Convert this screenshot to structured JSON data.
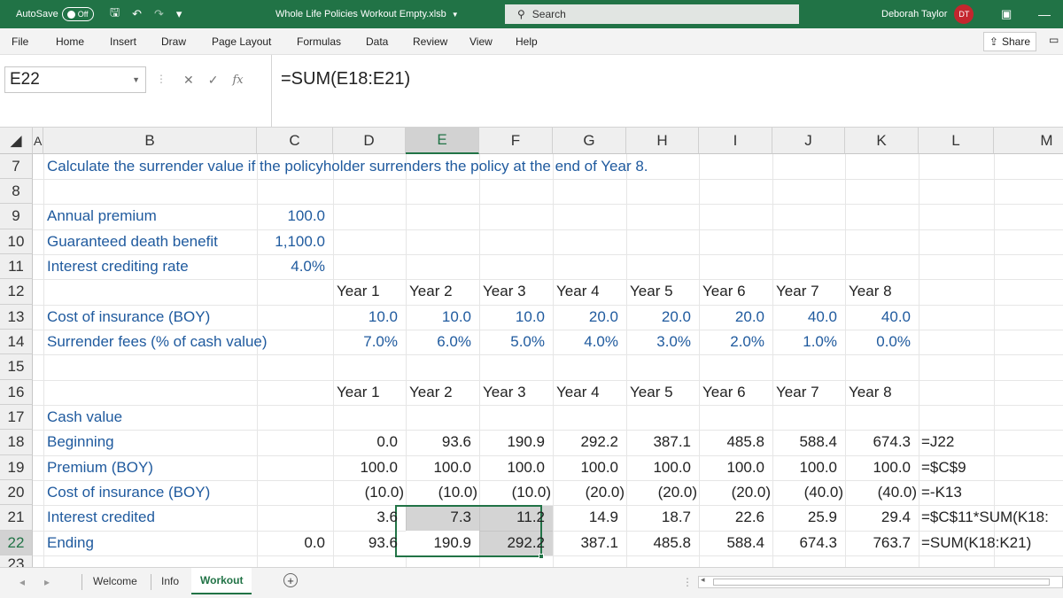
{
  "titlebar": {
    "autosave_label": "AutoSave",
    "autosave_state": "Off",
    "file_title": "Whole Life Policies Workout Empty.xlsb",
    "search_placeholder": "Search",
    "user_name": "Deborah Taylor",
    "user_initials": "DT"
  },
  "ribbon": {
    "tabs": [
      "File",
      "Home",
      "Insert",
      "Draw",
      "Page Layout",
      "Formulas",
      "Data",
      "Review",
      "View",
      "Help"
    ],
    "share_label": "Share"
  },
  "formula_bar": {
    "name_box": "E22",
    "formula": "=SUM(E18:E21)",
    "fx": "fx"
  },
  "columns": [
    "A",
    "B",
    "C",
    "D",
    "E",
    "F",
    "G",
    "H",
    "I",
    "J",
    "K",
    "L",
    "M"
  ],
  "rows": [
    "7",
    "8",
    "9",
    "10",
    "11",
    "12",
    "13",
    "14",
    "15",
    "16",
    "17",
    "18",
    "19",
    "20",
    "21",
    "22",
    "23"
  ],
  "cells": {
    "r7_b": "Calculate the surrender value if the policyholder surrenders the policy at the end of Year 8.",
    "r9_b": "Annual premium",
    "r9_c": "100.0",
    "r10_b": "Guaranteed death benefit",
    "r10_c": "1,100.0",
    "r11_b": "Interest crediting rate",
    "r11_c": "4.0%",
    "r12": [
      "Year 1",
      "Year 2",
      "Year 3",
      "Year 4",
      "Year 5",
      "Year 6",
      "Year 7",
      "Year 8"
    ],
    "r13_b": "Cost of insurance (BOY)",
    "r13": [
      "10.0",
      "10.0",
      "10.0",
      "20.0",
      "20.0",
      "20.0",
      "40.0",
      "40.0"
    ],
    "r14_b": "Surrender fees (% of cash value)",
    "r14": [
      "7.0%",
      "6.0%",
      "5.0%",
      "4.0%",
      "3.0%",
      "2.0%",
      "1.0%",
      "0.0%"
    ],
    "r16": [
      "Year 1",
      "Year 2",
      "Year 3",
      "Year 4",
      "Year 5",
      "Year 6",
      "Year 7",
      "Year 8"
    ],
    "r17_b": "Cash value",
    "r18_b": "Beginning",
    "r18": [
      "0.0",
      "93.6",
      "190.9",
      "292.2",
      "387.1",
      "485.8",
      "588.4",
      "674.3"
    ],
    "r18_l": "=J22",
    "r19_b": "Premium (BOY)",
    "r19": [
      "100.0",
      "100.0",
      "100.0",
      "100.0",
      "100.0",
      "100.0",
      "100.0",
      "100.0"
    ],
    "r19_l": "=$C$9",
    "r20_b": "Cost of insurance (BOY)",
    "r20": [
      "(10.0)",
      "(10.0)",
      "(10.0)",
      "(20.0)",
      "(20.0)",
      "(20.0)",
      "(40.0)",
      "(40.0)"
    ],
    "r20_l": "=-K13",
    "r21_b": "Interest credited",
    "r21": [
      "3.6",
      "7.3",
      "11.2",
      "14.9",
      "18.7",
      "22.6",
      "25.9",
      "29.4"
    ],
    "r21_l": "=$C$11*SUM(K18:",
    "r22_b": "Ending",
    "r22_c": "0.0",
    "r22": [
      "93.6",
      "190.9",
      "292.2",
      "387.1",
      "485.8",
      "588.4",
      "674.3",
      "763.7"
    ],
    "r22_l": "=SUM(K18:K21)"
  },
  "sheet_tabs": [
    "Welcome",
    "Info",
    "Workout"
  ],
  "active_sheet": "Workout",
  "colors": {
    "accent": "#217346",
    "text_blue": "#1f5a9e"
  }
}
